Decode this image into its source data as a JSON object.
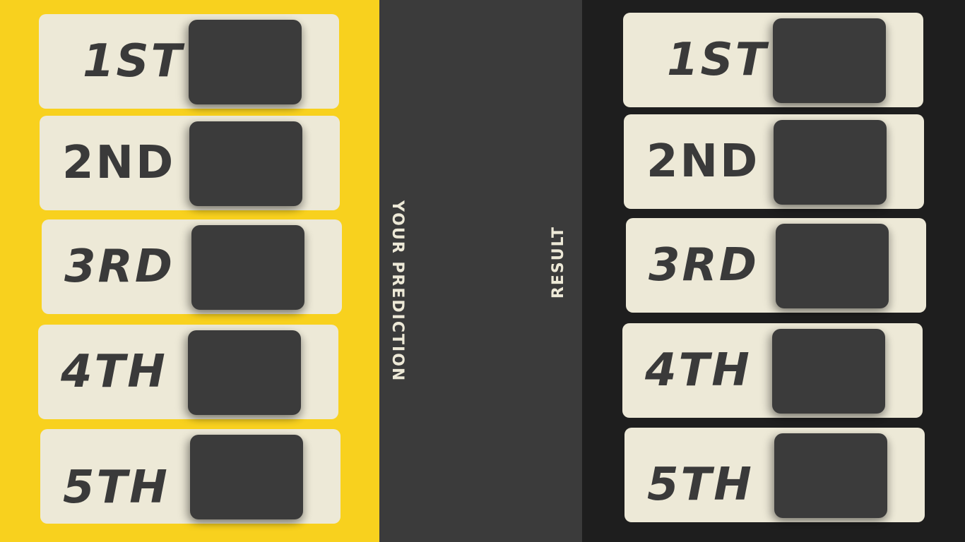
{
  "colors": {
    "prediction_background": "#f8d11e",
    "middle_background": "#3b3b3b",
    "result_background": "#1e1e1e",
    "card_background": "#ede9d7",
    "slot_background": "#3b3b3b",
    "text_dark": "#3a3a3a",
    "text_light": "#ede9d7"
  },
  "prediction": {
    "title": "YOUR PREDICTION",
    "ranks": [
      {
        "label": "1ST"
      },
      {
        "label": "2ND"
      },
      {
        "label": "3RD"
      },
      {
        "label": "4TH"
      },
      {
        "label": "5TH"
      }
    ]
  },
  "result": {
    "title": "RESULT",
    "ranks": [
      {
        "label": "1ST"
      },
      {
        "label": "2ND"
      },
      {
        "label": "3RD"
      },
      {
        "label": "4TH"
      },
      {
        "label": "5TH"
      }
    ]
  }
}
